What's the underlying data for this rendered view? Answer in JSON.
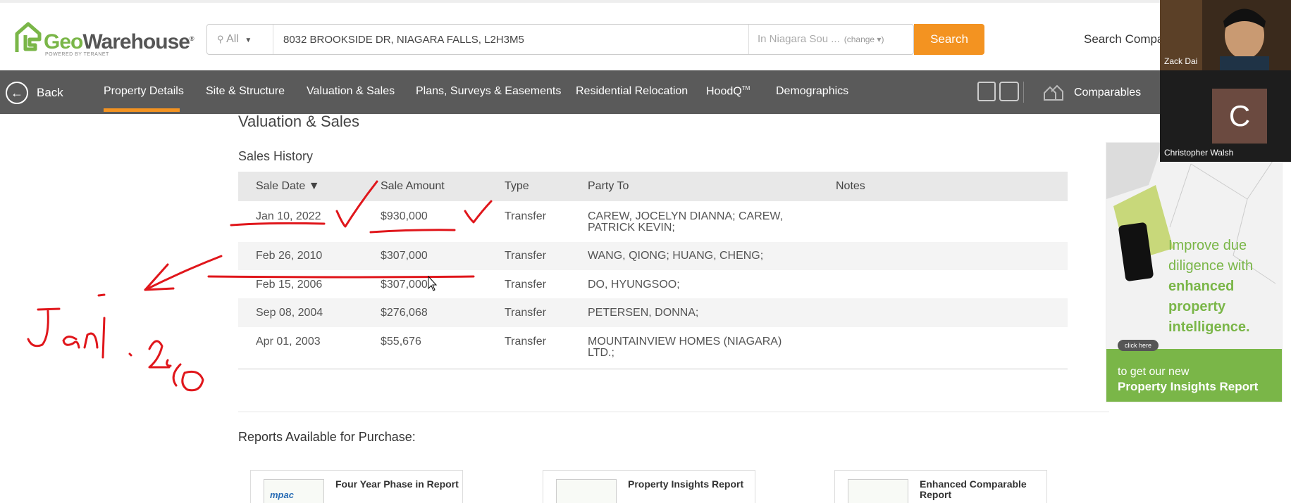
{
  "header": {
    "logo_text_geo": "Geo",
    "logo_text_rest": "Warehouse",
    "logo_sub": "POWERED BY TERANET",
    "search_scope": "All",
    "search_value": "8032 BROOKSIDE DR, NIAGARA FALLS, L2H3M5",
    "search_area": "In Niagara Sou ...",
    "search_area_change": "(change ▾)",
    "search_button": "Search",
    "search_comparables": "Search Compa"
  },
  "nav": {
    "back": "Back",
    "items": [
      "Property Details",
      "Site & Structure",
      "Valuation & Sales",
      "Plans, Surveys & Easements",
      "Residential Relocation",
      "HoodQ",
      "Demographics"
    ],
    "hoodq_tm": "TM",
    "comparables": "Comparables"
  },
  "content": {
    "section_title": "Valuation & Sales",
    "sales_history_title": "Sales History",
    "columns": [
      "Sale Date ▼",
      "Sale Amount",
      "Type",
      "Party To",
      "Notes"
    ],
    "rows": [
      {
        "date": "Jan 10, 2022",
        "amount": "$930,000",
        "type": "Transfer",
        "party": "CAREW, JOCELYN DIANNA; CAREW, PATRICK KEVIN;"
      },
      {
        "date": "Feb 26, 2010",
        "amount": "$307,000",
        "type": "Transfer",
        "party": "WANG, QIONG; HUANG, CHENG;"
      },
      {
        "date": "Feb 15, 2006",
        "amount": "$307,000",
        "type": "Transfer",
        "party": "DO, HYUNGSOO;"
      },
      {
        "date": "Sep 08, 2004",
        "amount": "$276,068",
        "type": "Transfer",
        "party": "PETERSEN, DONNA;"
      },
      {
        "date": "Apr 01, 2003",
        "amount": "$55,676",
        "type": "Transfer",
        "party": "MOUNTAINVIEW HOMES (NIAGARA) LTD.;"
      }
    ],
    "reports_title": "Reports Available for Purchase:",
    "reports": [
      {
        "name": "Four Year Phase in Report",
        "thumb": "mpac"
      },
      {
        "name": "Property Insights Report",
        "thumb": ""
      },
      {
        "name": "Enhanced Comparable Report",
        "thumb": ""
      }
    ]
  },
  "ad": {
    "line_a": "Improve due",
    "line_b": "diligence with",
    "line_c": "enhanced",
    "line_d": "property",
    "line_e": "intelligence.",
    "click_here": "click here",
    "bottom_1": "to get our new",
    "bottom_2": "Property Insights Report"
  },
  "participants": [
    {
      "name": "Zack Dai",
      "initial": ""
    },
    {
      "name": "Christopher Walsh",
      "initial": "C"
    }
  ],
  "colors": {
    "accent": "#f39321",
    "nav_bg": "#5a5a5a",
    "brand_green": "#7ab648",
    "ink": "#e0161b"
  }
}
